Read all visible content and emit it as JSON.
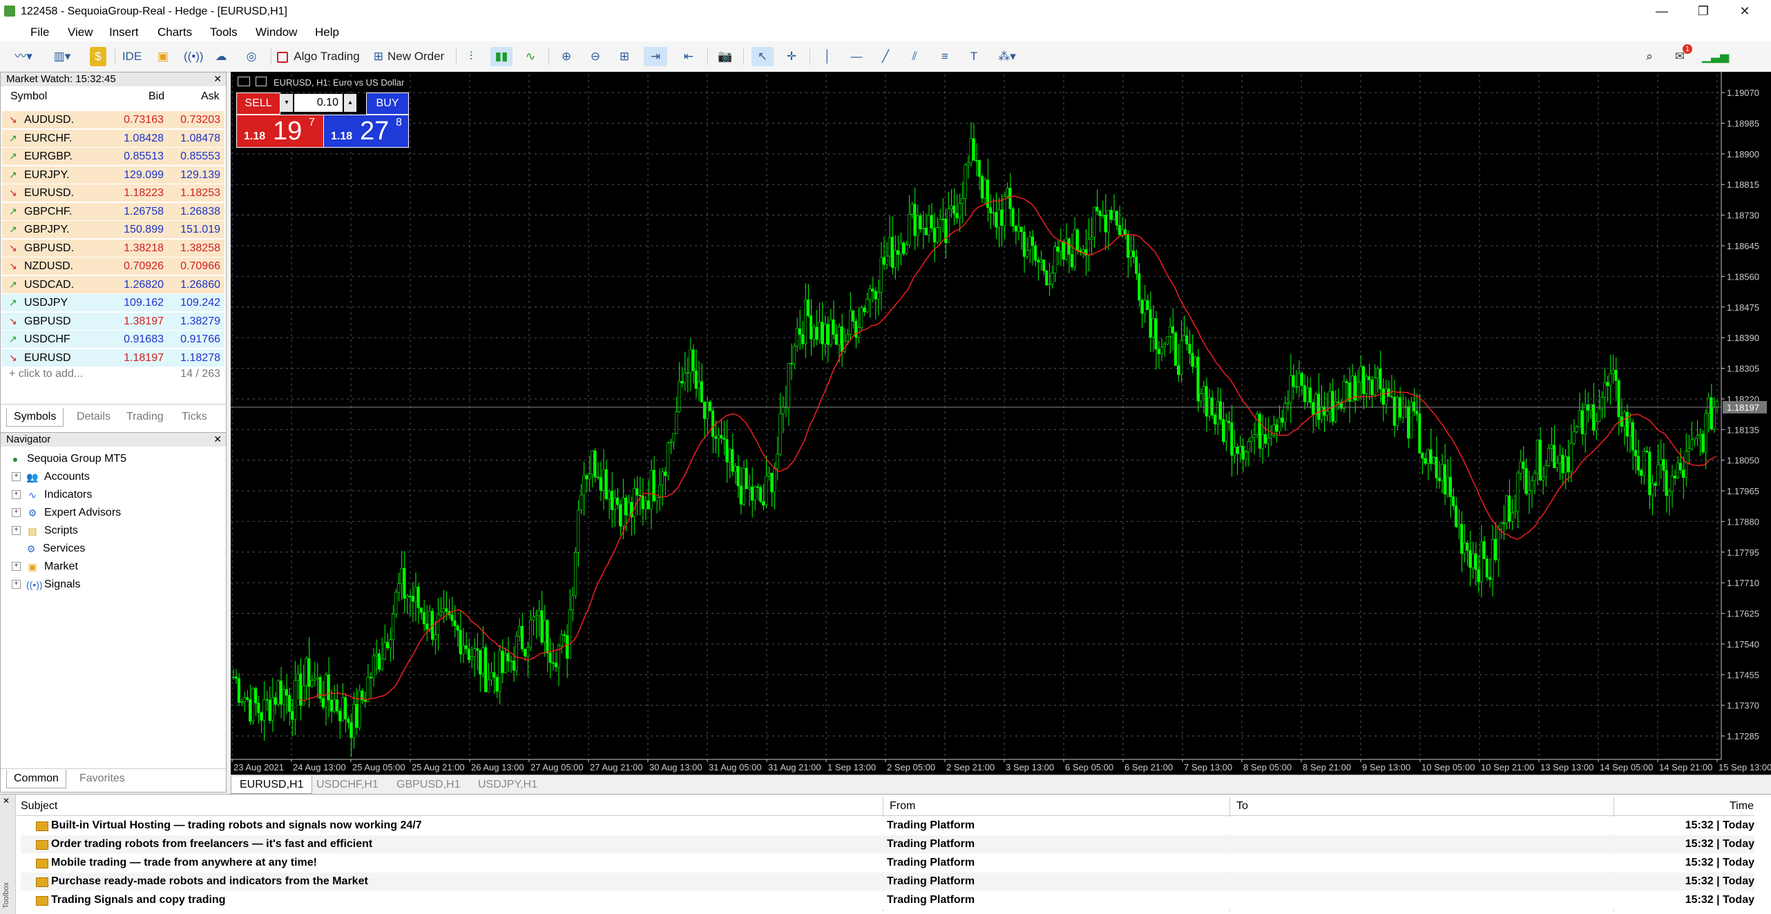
{
  "window": {
    "title": "122458 - SequoiaGroup-Real - Hedge - [EURUSD,H1]",
    "minimize": "—",
    "restore": "❐",
    "close": "✕"
  },
  "menu": [
    "File",
    "View",
    "Insert",
    "Charts",
    "Tools",
    "Window",
    "Help"
  ],
  "toolbar": {
    "ide_label": "IDE",
    "algo_trading_label": "Algo Trading",
    "new_order_label": "New Order",
    "notification_count": "1"
  },
  "market_watch": {
    "title": "Market Watch: 15:32:45",
    "columns": {
      "symbol": "Symbol",
      "bid": "Bid",
      "ask": "Ask"
    },
    "rows": [
      {
        "symbol": "AUDUSD.",
        "bid": "0.73163",
        "ask": "0.73203",
        "dir": "down",
        "bid_color": "red",
        "ask_color": "red",
        "bg": "#fbe6c8"
      },
      {
        "symbol": "EURCHF.",
        "bid": "1.08428",
        "ask": "1.08478",
        "dir": "up",
        "bid_color": "blue",
        "ask_color": "blue",
        "bg": "#fbe6c8"
      },
      {
        "symbol": "EURGBP.",
        "bid": "0.85513",
        "ask": "0.85553",
        "dir": "up",
        "bid_color": "blue",
        "ask_color": "blue",
        "bg": "#fbe6c8"
      },
      {
        "symbol": "EURJPY.",
        "bid": "129.099",
        "ask": "129.139",
        "dir": "up",
        "bid_color": "blue",
        "ask_color": "blue",
        "bg": "#fbe6c8"
      },
      {
        "symbol": "EURUSD.",
        "bid": "1.18223",
        "ask": "1.18253",
        "dir": "down",
        "bid_color": "red",
        "ask_color": "red",
        "bg": "#fbe6c8"
      },
      {
        "symbol": "GBPCHF.",
        "bid": "1.26758",
        "ask": "1.26838",
        "dir": "up",
        "bid_color": "blue",
        "ask_color": "blue",
        "bg": "#fbe6c8"
      },
      {
        "symbol": "GBPJPY.",
        "bid": "150.899",
        "ask": "151.019",
        "dir": "up",
        "bid_color": "blue",
        "ask_color": "blue",
        "bg": "#fbe6c8"
      },
      {
        "symbol": "GBPUSD.",
        "bid": "1.38218",
        "ask": "1.38258",
        "dir": "down",
        "bid_color": "red",
        "ask_color": "red",
        "bg": "#fbe6c8"
      },
      {
        "symbol": "NZDUSD.",
        "bid": "0.70926",
        "ask": "0.70966",
        "dir": "down",
        "bid_color": "red",
        "ask_color": "red",
        "bg": "#fbe6c8"
      },
      {
        "symbol": "USDCAD.",
        "bid": "1.26820",
        "ask": "1.26860",
        "dir": "up",
        "bid_color": "blue",
        "ask_color": "blue",
        "bg": "#fbe6c8"
      },
      {
        "symbol": "USDJPY",
        "bid": "109.162",
        "ask": "109.242",
        "dir": "up",
        "bid_color": "blue",
        "ask_color": "blue",
        "bg": "#dff6fb"
      },
      {
        "symbol": "GBPUSD",
        "bid": "1.38197",
        "ask": "1.38279",
        "dir": "down",
        "bid_color": "red",
        "ask_color": "blue",
        "bg": "#dff6fb"
      },
      {
        "symbol": "USDCHF",
        "bid": "0.91683",
        "ask": "0.91766",
        "dir": "up",
        "bid_color": "blue",
        "ask_color": "blue",
        "bg": "#dff6fb"
      },
      {
        "symbol": "EURUSD",
        "bid": "1.18197",
        "ask": "1.18278",
        "dir": "down",
        "bid_color": "red",
        "ask_color": "blue",
        "bg": "#dff6fb"
      }
    ],
    "add_label": "click to add...",
    "count": "14 / 263",
    "tabs": [
      "Symbols",
      "Details",
      "Trading",
      "Ticks"
    ]
  },
  "navigator": {
    "title": "Navigator",
    "root": "Sequoia Group MT5",
    "items": [
      "Accounts",
      "Indicators",
      "Expert Advisors",
      "Scripts",
      "Services",
      "Market",
      "Signals"
    ],
    "tabs": [
      "Common",
      "Favorites"
    ]
  },
  "chart": {
    "header": "EURUSD, H1:  Euro vs US Dollar",
    "sell_label": "SELL",
    "buy_label": "BUY",
    "volume": "0.10",
    "sell_big": "1.18",
    "sell_main": "19",
    "sell_sup": "7",
    "buy_big": "1.18",
    "buy_main": "27",
    "buy_sup": "8",
    "current_price": "1.18197",
    "price_ticks": [
      "1.19070",
      "1.18985",
      "1.18900",
      "1.18815",
      "1.18730",
      "1.18645",
      "1.18560",
      "1.18475",
      "1.18390",
      "1.18305",
      "1.18220",
      "1.18135",
      "1.18050",
      "1.17965",
      "1.17880",
      "1.17795",
      "1.17710",
      "1.17625",
      "1.17540",
      "1.17455",
      "1.17370",
      "1.17285"
    ],
    "time_ticks": [
      "23 Aug 2021",
      "24 Aug 13:00",
      "25 Aug 05:00",
      "25 Aug 21:00",
      "26 Aug 13:00",
      "27 Aug 05:00",
      "27 Aug 21:00",
      "30 Aug 13:00",
      "31 Aug 05:00",
      "31 Aug 21:00",
      "1 Sep 13:00",
      "2 Sep 05:00",
      "2 Sep 21:00",
      "3 Sep 13:00",
      "6 Sep 05:00",
      "6 Sep 21:00",
      "7 Sep 13:00",
      "8 Sep 05:00",
      "8 Sep 21:00",
      "9 Sep 13:00",
      "10 Sep 05:00",
      "10 Sep 21:00",
      "13 Sep 13:00",
      "14 Sep 05:00",
      "14 Sep 21:00",
      "15 Sep 13:00"
    ],
    "ylim": [
      1.1722,
      1.1912
    ],
    "bull_color": "#00ff00",
    "ma_color": "#ff2020",
    "close_path": [
      1.1745,
      1.1738,
      1.1735,
      1.1742,
      1.1738,
      1.1746,
      1.174,
      1.1737,
      1.1732,
      1.1745,
      1.1755,
      1.177,
      1.1766,
      1.176,
      1.1758,
      1.1757,
      1.175,
      1.1745,
      1.1747,
      1.1755,
      1.176,
      1.1754,
      1.1752,
      1.1802,
      1.1805,
      1.1796,
      1.179,
      1.1794,
      1.18,
      1.1812,
      1.1834,
      1.1818,
      1.181,
      1.18,
      1.1796,
      1.1793,
      1.1808,
      1.184,
      1.1845,
      1.184,
      1.1838,
      1.1843,
      1.1852,
      1.186,
      1.1866,
      1.1873,
      1.187,
      1.1866,
      1.188,
      1.1892,
      1.187,
      1.1876,
      1.1868,
      1.186,
      1.1858,
      1.1862,
      1.1866,
      1.187,
      1.1876,
      1.1866,
      1.1852,
      1.184,
      1.1836,
      1.1833,
      1.1825,
      1.1816,
      1.1812,
      1.181,
      1.1814,
      1.1818,
      1.1826,
      1.1822,
      1.1818,
      1.1822,
      1.1826,
      1.183,
      1.1826,
      1.1818,
      1.1815,
      1.1802,
      1.18,
      1.1785,
      1.1778,
      1.1775,
      1.179,
      1.18,
      1.1804,
      1.1808,
      1.1806,
      1.1814,
      1.182,
      1.1826,
      1.1815,
      1.1803,
      1.18,
      1.1798,
      1.1804,
      1.1812,
      1.1822
    ]
  },
  "chart_tabs": [
    "EURUSD,H1",
    "USDCHF,H1",
    "GBPUSD,H1",
    "USDJPY,H1"
  ],
  "toolbox": {
    "columns": {
      "subject": "Subject",
      "from": "From",
      "to": "To",
      "time": "Time"
    },
    "side_label": "Toolbox",
    "messages": [
      {
        "subject": "Built-in Virtual Hosting — trading robots and signals now working 24/7",
        "from": "Trading Platform",
        "time": "15:32 | Today"
      },
      {
        "subject": "Order trading robots from freelancers — it's fast and efficient",
        "from": "Trading Platform",
        "time": "15:32 | Today"
      },
      {
        "subject": "Mobile trading — trade from anywhere at any time!",
        "from": "Trading Platform",
        "time": "15:32 | Today"
      },
      {
        "subject": "Purchase ready-made robots and indicators from the Market",
        "from": "Trading Platform",
        "time": "15:32 | Today"
      },
      {
        "subject": "Trading Signals and copy trading",
        "from": "Trading Platform",
        "time": "15:32 | Today"
      }
    ]
  }
}
